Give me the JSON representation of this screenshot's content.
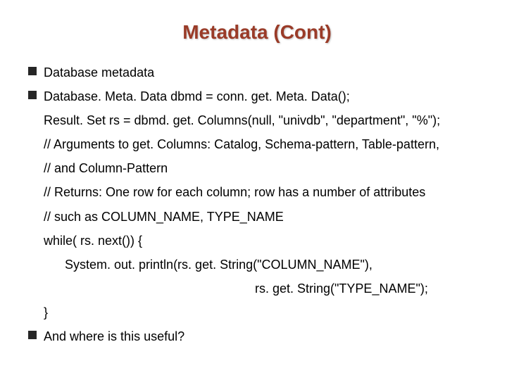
{
  "title": "Metadata (Cont)",
  "bullets": {
    "b1": "Database metadata",
    "b2": "Database. Meta. Data dbmd = conn. get. Meta. Data();",
    "b3": "And where is this useful?"
  },
  "code": {
    "l1": "Result. Set rs = dbmd. get. Columns(null, \"univdb\", \"department\", \"%\");",
    "l2": "// Arguments to get. Columns: Catalog, Schema-pattern, Table-pattern,",
    "l3": "// and Column-Pattern",
    "l4": "// Returns: One row for each column; row has a number of attributes",
    "l5": "// such as COLUMN_NAME, TYPE_NAME",
    "l6": "while( rs. next()) {",
    "l7": "System. out. println(rs. get. String(\"COLUMN_NAME\"),",
    "l8": "rs. get. String(\"TYPE_NAME\");",
    "l9": "}"
  }
}
